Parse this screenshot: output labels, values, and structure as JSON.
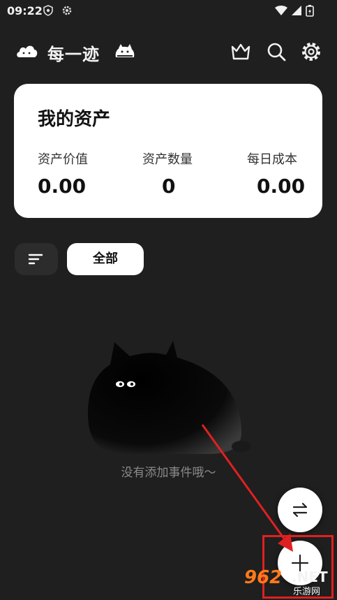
{
  "status_bar": {
    "time": "09:22"
  },
  "app": {
    "title": "每一迹"
  },
  "icons": {
    "crown": "crown-icon",
    "search": "search-icon",
    "settings": "gear-icon",
    "filter": "sort-icon",
    "swap": "swap-icon",
    "add": "plus-icon"
  },
  "asset_card": {
    "title": "我的资产",
    "stats": [
      {
        "label": "资产价值",
        "value": "0.00"
      },
      {
        "label": "资产数量",
        "value": "0"
      },
      {
        "label": "每日成本",
        "value": "0.00"
      }
    ]
  },
  "filters": {
    "active_chip": "全部"
  },
  "empty_state": {
    "message": "没有添加事件哦～"
  },
  "watermark": {
    "number": "962",
    "domain": ".NET",
    "site": "乐游网"
  },
  "colors": {
    "background": "#1f1f1f",
    "card": "#ffffff",
    "annotation": "#e02020",
    "watermark": "#ff7a1a"
  }
}
